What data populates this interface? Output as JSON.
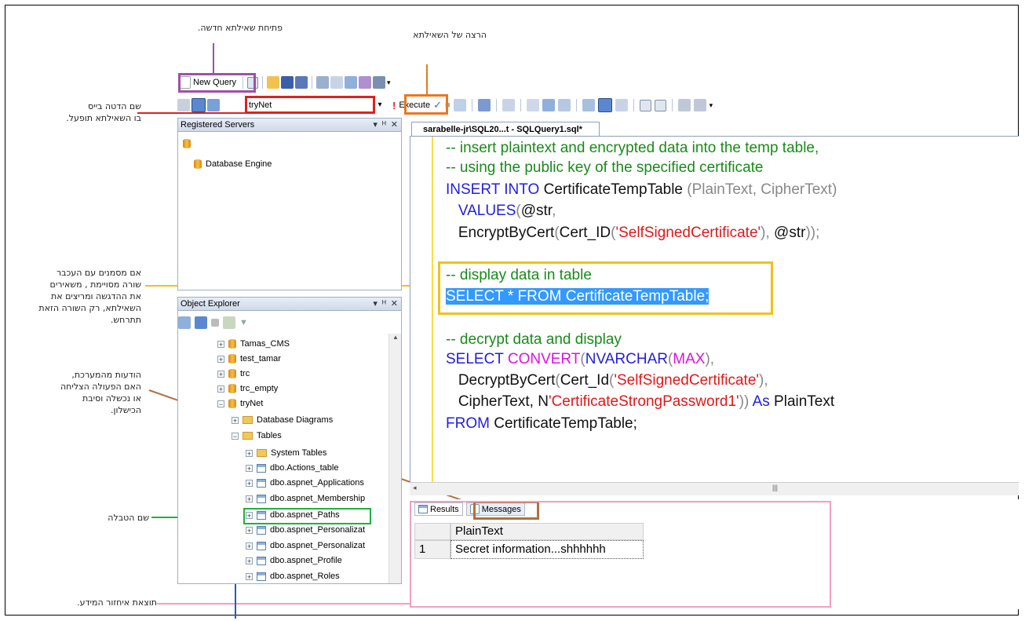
{
  "annotations": {
    "new_query": "פתיחת שאילתא חדשה.",
    "execute": "הרצה של השאילתא",
    "database": [
      "שם הדטה בייס",
      "בו השאילתא תופעל."
    ],
    "selection": [
      "אם מסמנים עם העכבר",
      "שורה מסויימת , משאירים",
      "את ההדגשה ומריצים את",
      "השאילתא, רק השורה הזאת",
      "תתרחש."
    ],
    "messages": [
      "הודעות מהמערכת,",
      "האם הפעולה הצליחה",
      "או נכשלה וסיבת",
      "הכישלון."
    ],
    "table_name": "שם הטבלה",
    "results": "תוצאת איחזור המידע."
  },
  "toolbar": {
    "new_query_label": "New Query",
    "database_value": "tryNet",
    "execute_label": "Execute"
  },
  "registered_servers": {
    "title": "Registered Servers",
    "item": "Database Engine"
  },
  "object_explorer": {
    "title": "Object Explorer",
    "databases": [
      "Tamas_CMS",
      "test_tamar",
      "trc",
      "trc_empty",
      "tryNet"
    ],
    "subnodes": [
      "Database Diagrams",
      "Tables"
    ],
    "system_tables": "System Tables",
    "tables": [
      "dbo.Actions_table",
      "dbo.aspnet_Applications",
      "dbo.aspnet_Membership",
      "dbo.aspnet_Paths",
      "dbo.aspnet_Personalizat",
      "dbo.aspnet_Personalizat",
      "dbo.aspnet_Profile",
      "dbo.aspnet_Roles"
    ]
  },
  "editor": {
    "tab_title": "sarabelle-jr\\SQL20...t - SQLQuery1.sql*",
    "lines": {
      "l1": "-- insert plaintext and encrypted data into the temp table,",
      "l2": "-- using the public key of the specified certificate",
      "l3a": "INSERT INTO",
      "l3b": " CertificateTempTable ",
      "l3c": "(PlainText, CipherText)",
      "l4a": "   VALUES",
      "l4b": "(",
      "l4c": "@str",
      "l4d": ",",
      "l5a": "   EncryptByCert",
      "l5b": "(",
      "l5c": "Cert_ID",
      "l5d": "(",
      "l5e": "'SelfSignedCertificate'",
      "l5f": "), ",
      "l5g": "@str",
      "l5h": "));",
      "l6": "-- display data in table",
      "l7": "SELECT * FROM CertificateTempTable;",
      "l8": "-- decrypt data and display",
      "l9a": "SELECT",
      "l9b": " CONVERT",
      "l9c": "(",
      "l9d": "NVARCHAR",
      "l9e": "(",
      "l9f": "MAX",
      "l9g": "),",
      "l10a": "   DecryptByCert",
      "l10b": "(",
      "l10c": "Cert_Id",
      "l10d": "(",
      "l10e": "'SelfSignedCertificate'",
      "l10f": "),",
      "l11a": "   CipherText, N",
      "l11b": "'CertificateStrongPassword1'",
      "l11c": "))",
      "l11d": " As",
      "l11e": " PlainText",
      "l12a": "FROM",
      "l12b": " CertificateTempTable;"
    }
  },
  "results": {
    "tab_results": "Results",
    "tab_messages": "Messages",
    "column_header": "PlainText",
    "row_number": "1",
    "row_value": "Secret information...shhhhhh"
  },
  "colors": {
    "purple": "#a050a8",
    "orange": "#e87820",
    "red": "#e02020",
    "yellow": "#f0c020",
    "brown": "#b07040",
    "green": "#20b040",
    "pink": "#f0a0c0",
    "blue": "#2060b0",
    "selection": "#3399ff"
  }
}
